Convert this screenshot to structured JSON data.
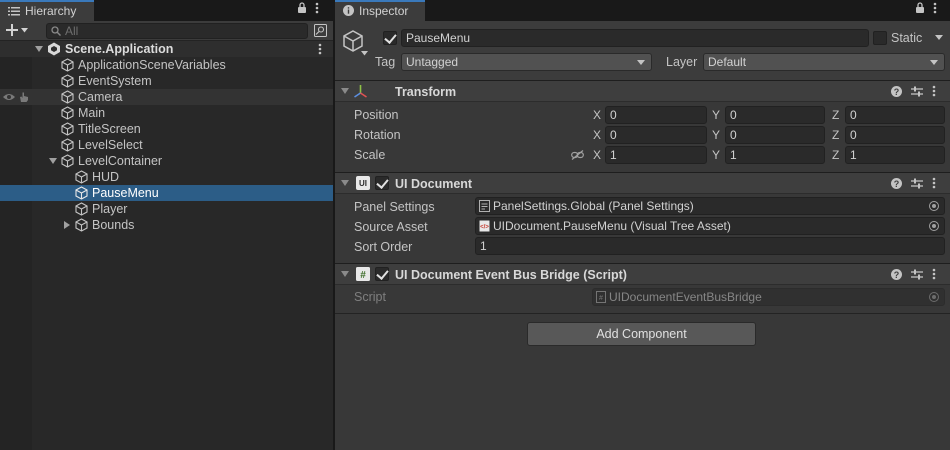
{
  "hierarchy": {
    "tab_label": "Hierarchy",
    "search_placeholder": "All",
    "scene_name": "Scene.Application",
    "items": [
      {
        "label": "ApplicationSceneVariables"
      },
      {
        "label": "EventSystem"
      },
      {
        "label": "Camera"
      },
      {
        "label": "Main"
      },
      {
        "label": "TitleScreen"
      },
      {
        "label": "LevelSelect"
      },
      {
        "label": "LevelContainer"
      },
      {
        "label": "HUD"
      },
      {
        "label": "PauseMenu"
      },
      {
        "label": "Player"
      },
      {
        "label": "Bounds"
      }
    ],
    "selected_item": "PauseMenu"
  },
  "inspector": {
    "tab_label": "Inspector",
    "object_name": "PauseMenu",
    "static_label": "Static",
    "tag_label": "Tag",
    "tag_value": "Untagged",
    "layer_label": "Layer",
    "layer_value": "Default",
    "transform": {
      "title": "Transform",
      "rows": [
        {
          "label": "Position",
          "x": "0",
          "y": "0",
          "z": "0"
        },
        {
          "label": "Rotation",
          "x": "0",
          "y": "0",
          "z": "0"
        },
        {
          "label": "Scale",
          "x": "1",
          "y": "1",
          "z": "1"
        }
      ],
      "axis_x": "X",
      "axis_y": "Y",
      "axis_z": "Z"
    },
    "ui_document": {
      "title": "UI Document",
      "icon_text": "UI",
      "panel_settings_label": "Panel Settings",
      "panel_settings_value": "PanelSettings.Global (Panel Settings)",
      "source_asset_label": "Source Asset",
      "source_asset_value": "UIDocument.PauseMenu (Visual Tree Asset)",
      "sort_order_label": "Sort Order",
      "sort_order_value": "1"
    },
    "event_bus": {
      "title": "UI Document Event Bus Bridge (Script)",
      "script_label": "Script",
      "script_value": "UIDocumentEventBusBridge"
    },
    "add_component_label": "Add Component"
  },
  "colors": {
    "selection": "#2c5d87",
    "tab_accent": "#3a79bb",
    "panel_bg": "#383838"
  }
}
